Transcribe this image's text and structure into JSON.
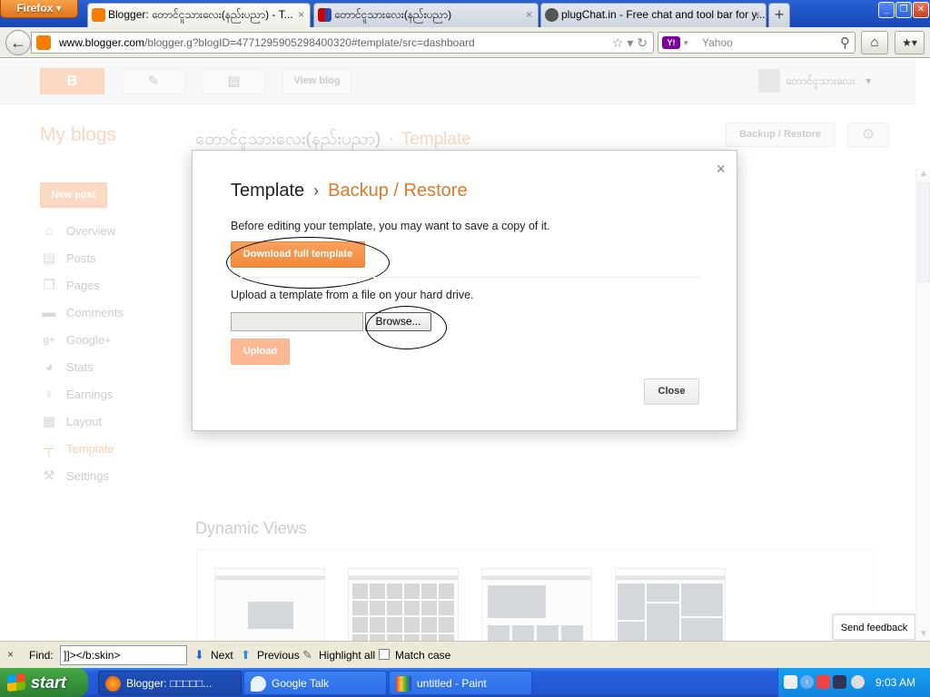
{
  "browser": {
    "app_button": "Firefox ▾",
    "tabs": [
      {
        "label": "Blogger: တောင်ငူသားလေး(နည်းပညာ) - T...",
        "active": true,
        "icon": "blogger-icon"
      },
      {
        "label": "တောင်ငူသားလေး(နည်းပညာ)",
        "active": false,
        "icon": "flag-icon"
      },
      {
        "label": "plugChat.in - Free chat and tool bar for y...",
        "active": false,
        "icon": "plug-icon"
      }
    ],
    "tab_close": "×",
    "new_tab": "+",
    "window_controls": {
      "minimize": "_",
      "restore": "❐",
      "close": "✕"
    },
    "back": "←",
    "url": {
      "host": "www.blogger.com",
      "path": "/blogger.g?blogID=4771295905298400320#template/src=dashboard"
    },
    "url_icons": "☆ ▾ ↻",
    "search": {
      "engine": "Y!",
      "placeholder": "Yahoo"
    },
    "home": "⌂",
    "bookmarks": "★▾"
  },
  "blogger": {
    "header": {
      "buttons": [
        {
          "name": "blogger-logo-button",
          "icon": "blogger-icon",
          "label": "B"
        },
        {
          "name": "new-post-pencil-button",
          "icon": "pencil-icon",
          "label": "✎"
        },
        {
          "name": "posts-list-button",
          "icon": "document-icon",
          "label": "▤"
        },
        {
          "name": "view-blog-button",
          "label": "View blog"
        }
      ],
      "profile_name": "တောင်ငူသားလေး",
      "profile_dropdown": "▾"
    },
    "my_blogs": "My blogs",
    "blog_title": "တောင်ငူသားလေး(နည်းပညာ)",
    "title_sep": "·",
    "section": "Template",
    "backup_restore": "Backup / Restore",
    "gear": "⚙",
    "new_post": "New post",
    "sidebar": [
      {
        "label": "Overview",
        "icon": "home-icon",
        "glyph": "⌂"
      },
      {
        "label": "Posts",
        "icon": "posts-icon",
        "glyph": "▤"
      },
      {
        "label": "Pages",
        "icon": "pages-icon",
        "glyph": "❐"
      },
      {
        "label": "Comments",
        "icon": "comment-icon",
        "glyph": "▬"
      },
      {
        "label": "Google+",
        "icon": "google-plus-icon",
        "glyph": "g+"
      },
      {
        "label": "Stats",
        "icon": "pie-chart-icon",
        "glyph": "◕"
      },
      {
        "label": "Earnings",
        "icon": "trophy-icon",
        "glyph": "♆"
      },
      {
        "label": "Layout",
        "icon": "layout-icon",
        "glyph": "▦"
      },
      {
        "label": "Template",
        "icon": "paint-roller-icon",
        "glyph": "┬",
        "active": true
      },
      {
        "label": "Settings",
        "icon": "wrench-icon",
        "glyph": "⚒"
      }
    ],
    "dynamic_views": "Dynamic Views",
    "send_feedback": "Send feedback"
  },
  "modal": {
    "close_x": "×",
    "title": "Template",
    "chevron": "›",
    "subtitle": "Backup / Restore",
    "save_text": "Before editing your template, you may want to save a copy of it.",
    "download_button": "Download full template",
    "upload_text": "Upload a template from a file on your hard drive.",
    "file_value": "",
    "browse_button": "Browse...",
    "upload_button": "Upload",
    "close_button": "Close"
  },
  "findbar": {
    "close": "×",
    "label": "Find:",
    "value": "]]></b:skin>",
    "next": "Next",
    "previous": "Previous",
    "highlight_all": "Highlight all",
    "match_case": "Match case",
    "match_case_checked": false
  },
  "taskbar": {
    "start": "start",
    "tasks": [
      {
        "label": "Blogger: □□□□□...",
        "icon": "firefox-icon",
        "active": true
      },
      {
        "label": "Google Talk",
        "icon": "google-talk-icon",
        "active": false
      },
      {
        "label": "untitled - Paint",
        "icon": "paint-icon",
        "active": false
      }
    ],
    "tray_icons": [
      "keyboard-icon",
      "show-hidden-icon",
      "gmail-notifier-icon",
      "network-icon",
      "messenger-icon"
    ],
    "clock": "9:03 AM"
  },
  "colors": {
    "accent_orange": "#f08a3a",
    "crumb_orange": "#dd7a2a",
    "upload_disabled": "#fbb892"
  }
}
